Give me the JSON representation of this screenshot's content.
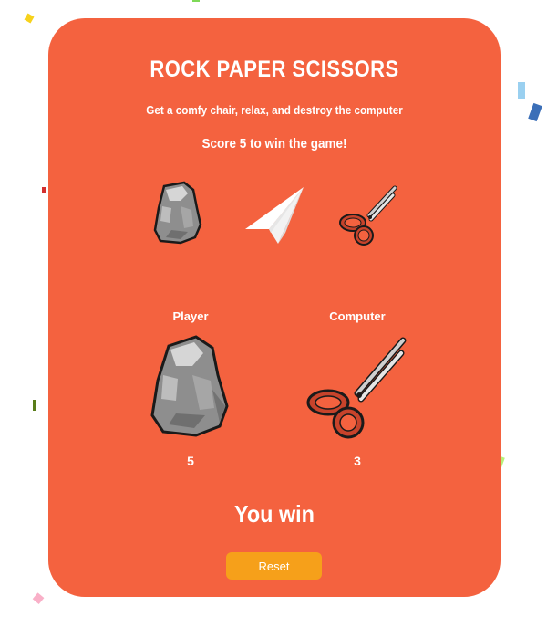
{
  "header": {
    "title": "ROCK PAPER SCISSORS",
    "subtitle": "Get a comfy chair, relax, and destroy the computer",
    "goal": "Score 5 to win the game!"
  },
  "choices": [
    {
      "name": "rock",
      "icon": "rock-icon"
    },
    {
      "name": "paper",
      "icon": "paper-plane-icon"
    },
    {
      "name": "scissors",
      "icon": "scissors-icon"
    }
  ],
  "player": {
    "label": "Player",
    "score": "5",
    "selection": "rock"
  },
  "computer": {
    "label": "Computer",
    "score": "3",
    "selection": "scissors"
  },
  "result": "You win",
  "reset_label": "Reset",
  "colors": {
    "card": "#f4623f",
    "button": "#f6a01a",
    "text": "#ffffff"
  }
}
